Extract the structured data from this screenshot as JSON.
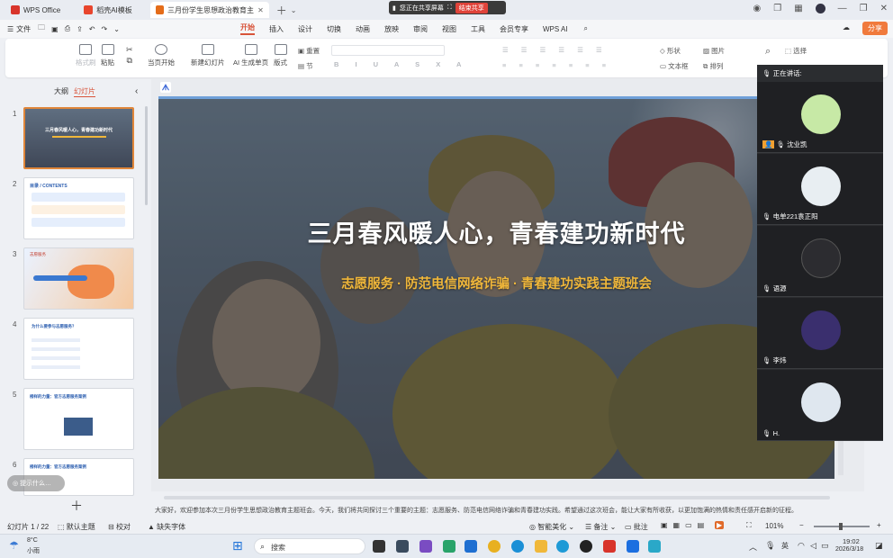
{
  "titlebar": {
    "tabs": [
      {
        "label": "WPS Office",
        "color": "#d8342b"
      },
      {
        "label": "稻壳AI模板",
        "color": "#e8452d"
      },
      {
        "label": "三月份学生思想政治教育主题班会",
        "color": "#e46c1a"
      }
    ],
    "share_status": "您正在共享屏幕",
    "stop_share": "结束共享"
  },
  "menubar": {
    "file": "文件",
    "items": [
      "开始",
      "插入",
      "设计",
      "切换",
      "动画",
      "放映",
      "审阅",
      "视图",
      "工具",
      "会员专享",
      "WPS AI"
    ],
    "active": "开始",
    "share_button": "分享"
  },
  "ribbon": {
    "format_painter": "格式刷",
    "paste": "粘贴",
    "play_from_current": "当页开始",
    "new_slide": "新建幻灯片",
    "ai_generate": "AI 生成单页",
    "layout": "版式",
    "reset": "重置",
    "section": "节",
    "shape": "形状",
    "picture": "图片",
    "textbox": "文本框",
    "arrange": "排列",
    "select": "选择"
  },
  "leftpanel": {
    "tab_outline": "大纲",
    "tab_slides": "幻灯片",
    "thumbs": [
      {
        "num": "1",
        "title": "三月春风暖人心，青春建功新时代"
      },
      {
        "num": "2",
        "title": "目录 / CONTENTS"
      },
      {
        "num": "3",
        "title": "志愿服务"
      },
      {
        "num": "4",
        "title": "为什么要参与志愿服务？"
      },
      {
        "num": "5",
        "title": "榜样的力量：官方志愿服务案例"
      },
      {
        "num": "6",
        "title": "榜样的力量：官方志愿服务案例"
      }
    ],
    "hint": "提示什么…"
  },
  "slide": {
    "title": "三月春风暖人心，青春建功新时代",
    "subtitle": "志愿服务 · 防范电信网络诈骗 · 青春建功实践主题班会"
  },
  "videopanel": {
    "speaking_label": "正在讲话:",
    "participants": [
      {
        "name": "沈业凯",
        "color": "#c7e9a6"
      },
      {
        "name": "电单221袁正阳",
        "color": "#e8eef2"
      },
      {
        "name": "语源",
        "color": "#2c2c30"
      },
      {
        "name": "李炜",
        "color": "#3a2f6e"
      },
      {
        "name": "H.",
        "color": "#dfe7ef"
      }
    ]
  },
  "notes": "大家好，欢迎参加本次三月份学生思想政治教育主题班会。今天，我们将共同探讨三个重要的主题：志愿服务、防范电信网络诈骗和青春建功实践。希望通过这次班会，能让大家有所收获，以更加饱满的热情和责任感开启新的征程。",
  "statusbar": {
    "slide_count": "幻灯片 1 / 22",
    "theme": "默认主题",
    "proofread": "校对",
    "missing_font": "缺失字体",
    "smart_beautify": "智能美化",
    "notes": "备注",
    "comments": "批注",
    "zoom": "101%"
  },
  "taskbar": {
    "weather_temp": "8°C",
    "weather_desc": "小雨",
    "search_placeholder": "搜索",
    "ime": "英",
    "time": "19:02",
    "date": "2026/3/18"
  }
}
